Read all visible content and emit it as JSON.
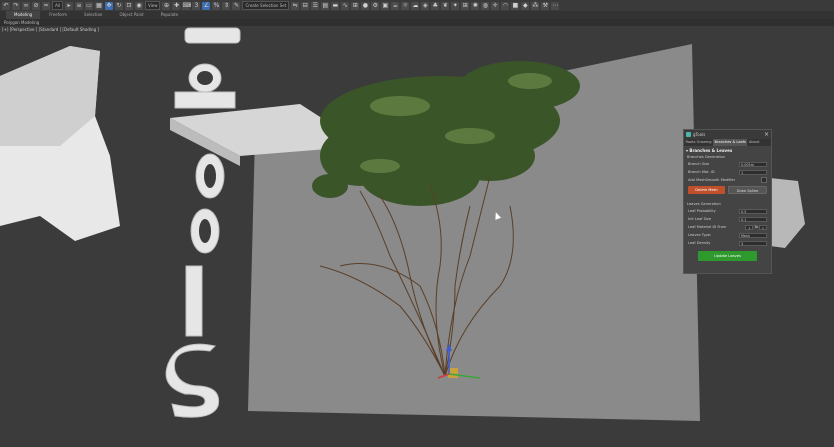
{
  "toolbar": {
    "selection_filter": "All",
    "view_dropdown": "View",
    "named_selection": "Create Selection Set"
  },
  "ribbon": {
    "tabs": [
      "Modeling",
      "Freeform",
      "Selection",
      "Object Paint",
      "Populate"
    ],
    "active_tab": "Modeling",
    "subbar_label": "Polygon Modeling"
  },
  "viewport": {
    "label": "[+] [Perspective ] [Standard ] [Default Shading ]",
    "letters": [
      "O",
      "T",
      "O",
      "O",
      "L",
      "S"
    ]
  },
  "panel": {
    "title": "gTools",
    "tabs": [
      "Roots Growing",
      "Branches & Leafs",
      "About"
    ],
    "active_tab": "Branches & Leafs",
    "section_title": "Branches & Leaves",
    "branches_subtitle": "Branches Generation",
    "branch_size_label": "Branch Size",
    "branch_size_value": "0.005m",
    "branch_mat_label": "Branch Mat. ID",
    "branch_mat_value": "1",
    "smooth_label": "Add MeshSmooth Modifier",
    "delete_mesh": "Delete Mesh",
    "draw_spline": "Draw Spline",
    "leaves_subtitle": "Leaves Generation",
    "leaf_prob_label": "Leaf Probability",
    "leaf_prob_value": "0.5",
    "leaf_size_label": "Init Leaf Size",
    "leaf_size_value": "0.1",
    "leaf_mat_label": "Leaf Material ID From",
    "leaf_mat_from": "1",
    "leaf_mat_to_label": "To",
    "leaf_mat_to": "1",
    "leaves_type_label": "Leaves Type:",
    "leaves_type_value": "Mesh",
    "leaf_density_label": "Leaf Density",
    "leaf_density_value": "3",
    "update_leaves": "Update Leaves"
  },
  "colors": {
    "accent_red": "#c0502c",
    "accent_green": "#2e9a2e",
    "teal_logo": "#4db6ac"
  }
}
